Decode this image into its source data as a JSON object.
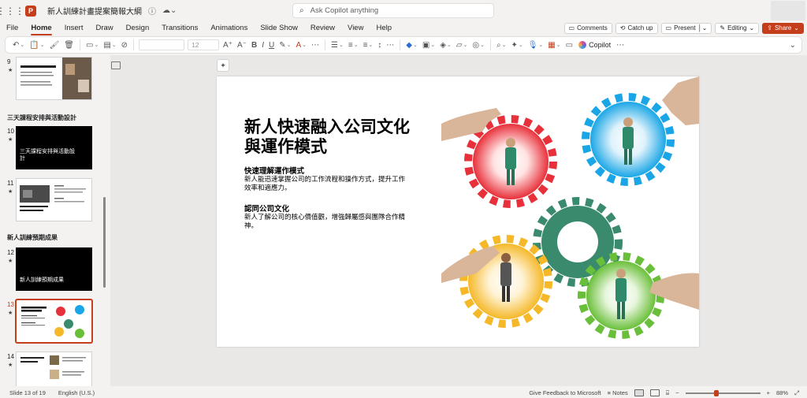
{
  "titlebar": {
    "doc_title": "新人訓練計畫提案簡報大綱",
    "search_placeholder": "Ask Copilot anything"
  },
  "menu": {
    "tabs": [
      "File",
      "Home",
      "Insert",
      "Draw",
      "Design",
      "Transitions",
      "Animations",
      "Slide Show",
      "Review",
      "View",
      "Help"
    ],
    "active_tab": "Home",
    "comments": "Comments",
    "catch_up": "Catch up",
    "present": "Present",
    "editing": "Editing",
    "share": "Share"
  },
  "ribbon": {
    "font_size": "12",
    "copilot": "Copilot"
  },
  "thumbnails": {
    "slide9": {
      "num": "9"
    },
    "section_schedule": "三天課程安排與活動設計",
    "slide10": {
      "num": "10",
      "title": "三天課程安排與活動設計"
    },
    "slide11": {
      "num": "11"
    },
    "section_outcome": "新人訓練預期成果",
    "slide12": {
      "num": "12",
      "title": "新人訓練預期成果"
    },
    "slide13": {
      "num": "13"
    },
    "slide14": {
      "num": "14"
    }
  },
  "slide": {
    "title": "新人快速融入公司文化與運作模式",
    "point1_head": "快速理解運作模式",
    "point1_body": "新人能迅速掌握公司的工作流程和操作方式，提升工作效率和適應力。",
    "point2_head": "認同公司文化",
    "point2_body": "新人了解公司的核心價值觀，增強歸屬感與團隊合作精神。"
  },
  "status": {
    "slide_pos": "Slide 13 of 19",
    "language": "English (U.S.)",
    "feedback": "Give Feedback to Microsoft",
    "notes": "Notes",
    "zoom": "88%"
  },
  "colors": {
    "accent": "#c43e1c",
    "gear_red": "#e8303a",
    "gear_blue": "#1aa6e6",
    "gear_teal": "#3a8a6e",
    "gear_yellow": "#f5b829",
    "gear_green": "#6abf3a"
  }
}
